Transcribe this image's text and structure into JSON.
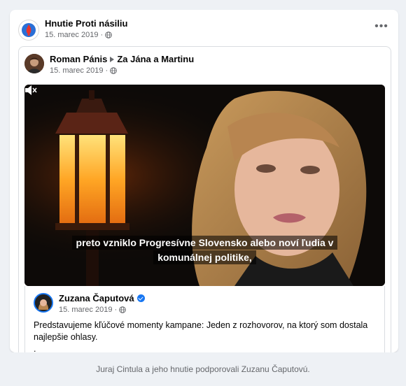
{
  "post": {
    "page_name": "Hnutie Proti násiliu",
    "date": "15. marec 2019",
    "more_label": "•••",
    "privacy_icon": "globe-icon"
  },
  "shared_post": {
    "author": "Roman Pánis",
    "target": "Za Jána a Martinu",
    "date": "15. marec 2019",
    "privacy_icon": "globe-icon"
  },
  "video": {
    "subtitle": "preto vzniklo Progresívne Slovensko alebo noví ľudia v komunálnej politike,",
    "mute_icon": "speaker-muted-icon"
  },
  "original_post": {
    "author": "Zuzana Čaputová",
    "verified_icon": "verified-badge-icon",
    "date": "15. marec 2019",
    "text": "Predstavujeme kľúčové momenty kampane: Jeden z rozhovorov, na ktorý som dostala najlepšie ohlasy.",
    "text_tail": "."
  },
  "caption": "Juraj Cintula a jeho hnutie podporovali Zuzanu Čaputovú.",
  "colors": {
    "accent": "#1877f2",
    "muted_text": "#65676b",
    "background": "#eef1f5"
  }
}
